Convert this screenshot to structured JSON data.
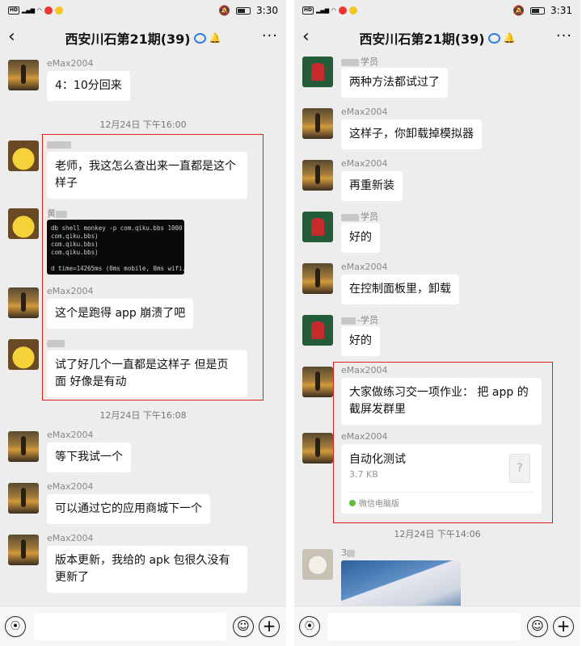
{
  "left": {
    "status_time": "3:30",
    "title": "西安川石第21期(39)",
    "messages": [
      {
        "sender": "eMax2004",
        "text": "4：10分回来"
      },
      {
        "time": "12月24日 下午16:00"
      },
      {
        "text": "老师，我这怎么查出来一直都是这个样子"
      },
      {
        "sender_prefix": "黄",
        "terminal_lines": [
          "db shell monkey -p com.qiku.bbs 1000",
          "com.qiku.bbs)",
          "com.qiku.bbs)",
          "com.qiku.bbs)",
          "",
          "d time=14265ms (0ms mobile, 0ms wifi,"
        ]
      },
      {
        "sender": "eMax2004",
        "text": "这个是跑得 app 崩溃了吧"
      },
      {
        "text": "试了好几个一直都是这样子 但是页面 好像是有动"
      },
      {
        "time": "12月24日 下午16:08"
      },
      {
        "sender": "eMax2004",
        "text": "等下我试一个"
      },
      {
        "sender": "eMax2004",
        "text": "可以通过它的应用商城下一个"
      },
      {
        "sender": "eMax2004",
        "text": "版本更新，我给的 apk 包很久没有更新了"
      }
    ]
  },
  "right": {
    "status_time": "3:31",
    "title": "西安川石第21期(39)",
    "messages": [
      {
        "sender": "学员",
        "text": "两种方法都试过了"
      },
      {
        "sender": "eMax2004",
        "text": "这样子，你卸载掉模拟器"
      },
      {
        "sender": "eMax2004",
        "text": "再重新装"
      },
      {
        "sender": "学员",
        "text": "好的"
      },
      {
        "sender": "eMax2004",
        "text": "在控制面板里，卸载"
      },
      {
        "sender": "-学员",
        "text": "好的"
      },
      {
        "sender": "eMax2004",
        "text": "大家做练习交一项作业： 把 app 的截屏发群里"
      },
      {
        "sender": "eMax2004",
        "file_name": "自动化测试",
        "file_size": "3.7 KB",
        "file_source": "微信电脑版",
        "file_icon": "?"
      },
      {
        "time": "12月24日 下午14:06"
      },
      {
        "sender": "3"
      }
    ]
  },
  "icons": {
    "back": "‹",
    "more": "···",
    "voice": "⦿",
    "emoji": "☺",
    "plus": "+"
  }
}
